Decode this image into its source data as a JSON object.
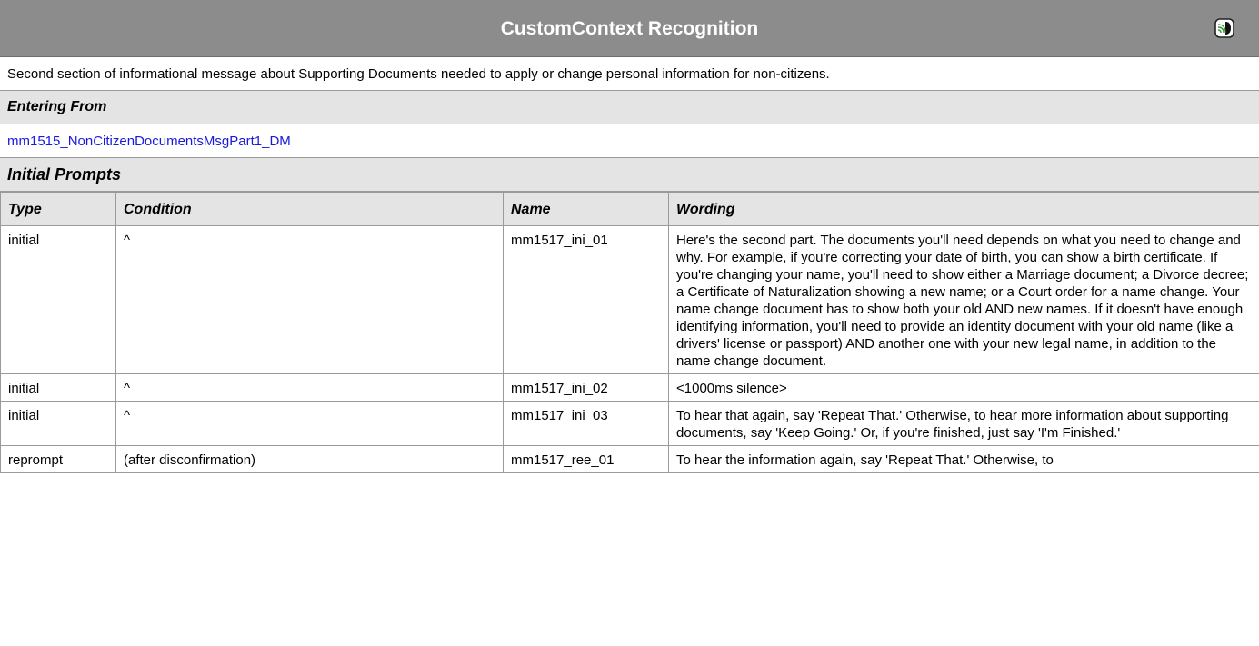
{
  "header": {
    "title": "CustomContext Recognition",
    "icon": "speech-icon"
  },
  "description": "Second section of informational message about Supporting Documents needed to apply or change personal information for non-citizens.",
  "entering_from": {
    "label": "Entering From",
    "link": "mm1515_NonCitizenDocumentsMsgPart1_DM"
  },
  "initial_prompts": {
    "label": "Initial Prompts",
    "columns": {
      "type": "Type",
      "condition": "Condition",
      "name": "Name",
      "wording": "Wording"
    },
    "rows": [
      {
        "type": "initial",
        "condition": "^",
        "name": "mm1517_ini_01",
        "wording": "Here's the second part. The documents you'll need depends on what you need to change and why. For example, if you're correcting your date of birth, you can show a birth certificate. If you're changing your name, you'll need to show either a Marriage document; a Divorce decree; a Certificate of Naturalization showing a new name; or a Court order for a name change. Your name change document has to show both your old AND new names. If it doesn't have enough identifying information, you'll need to provide an identity document with your old name (like a drivers' license or passport) AND another one with your new legal name, in addition to the name change document."
      },
      {
        "type": "initial",
        "condition": "^",
        "name": "mm1517_ini_02",
        "wording": "<1000ms silence>"
      },
      {
        "type": "initial",
        "condition": "^",
        "name": "mm1517_ini_03",
        "wording": "To hear that again, say 'Repeat That.' Otherwise, to hear more information about supporting documents, say 'Keep Going.' Or, if you're finished, just say 'I'm Finished.'"
      },
      {
        "type": "reprompt",
        "condition": "(after disconfirmation)",
        "name": "mm1517_ree_01",
        "wording": "To hear the information again, say 'Repeat That.' Otherwise, to"
      }
    ]
  }
}
